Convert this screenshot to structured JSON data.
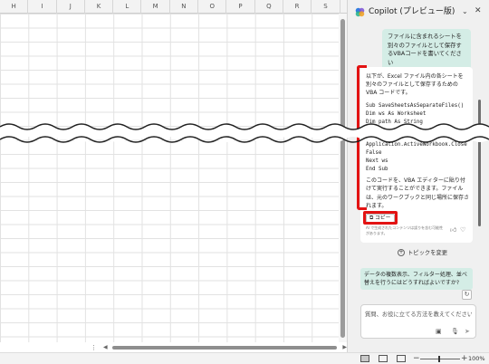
{
  "spreadsheet": {
    "columns": [
      "H",
      "I",
      "J",
      "K",
      "L",
      "M",
      "N",
      "O",
      "P",
      "Q",
      "R",
      "S"
    ],
    "scroll_dots": "⋮"
  },
  "copilot": {
    "title": "Copilot (プレビュー版)",
    "menu_icon": "chevron-down-icon",
    "close_icon": "close-icon",
    "user_message": "ファイルに含まれるシートを別々のファイルとして保存するVBAコードを書いてください",
    "reply": {
      "intro": "以下が、Excel ファイル内の各シートを別々のファイルとして保存するためのVBA コードです。",
      "code_top": [
        "Sub SaveSheetsAsSeparateFiles()",
        "    Dim ws As Worksheet",
        "    Dim path As String"
      ],
      "code_bottom": [
        "Application.ActiveWorkbook.Close",
        "False",
        "    Next ws",
        "End Sub"
      ],
      "outro": "このコードを、VBA エディターに貼り付けて実行することができます。ファイルは、元のワークブックと同じ場所に保存されます。",
      "copy_label": "コピー",
      "ai_note": "AI で生成されたコンテンツは誤りを含む可能性があります。"
    },
    "change_topic": "トピックを変更",
    "suggestion": "データの複数表示、フィルター処理、並べ替えを行うにはどうすればよいですか?",
    "input_placeholder": "質問、お役に立てる方法を教えてください",
    "accent_color": "#d4ede6",
    "highlight_color": "#e31313"
  },
  "statusbar": {
    "zoom_level": "100%"
  }
}
